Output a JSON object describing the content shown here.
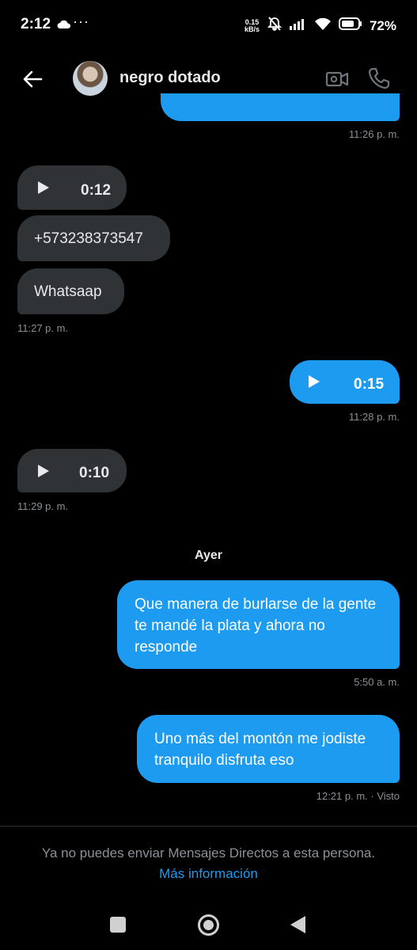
{
  "status_bar": {
    "time": "2:12",
    "dots": "···",
    "net_speed_value": "0.15",
    "net_speed_unit": "kB/s",
    "battery": "72%",
    "icons": [
      "cloud-icon",
      "mute-icon",
      "signal-icon",
      "wifi-icon",
      "battery-icon"
    ]
  },
  "header": {
    "contact_name": "negro dotado",
    "icons": [
      "back-arrow-icon",
      "video-call-icon",
      "phone-icon"
    ]
  },
  "messages": [
    {
      "direction": "out",
      "type": "text",
      "text": "",
      "timestamp": "11:26 p. m."
    },
    {
      "direction": "in",
      "type": "audio",
      "duration": "0:12"
    },
    {
      "direction": "in",
      "type": "text",
      "text": "+573238373547"
    },
    {
      "direction": "in",
      "type": "text",
      "text": "Whatsaap",
      "timestamp": "11:27 p. m."
    },
    {
      "direction": "out",
      "type": "audio",
      "duration": "0:15",
      "timestamp": "11:28 p. m."
    },
    {
      "direction": "in",
      "type": "audio",
      "duration": "0:10",
      "timestamp": "11:29 p. m."
    },
    {
      "direction": "out",
      "type": "text",
      "text": "Que manera de burlarse de la gente te mandé la plata y ahora no responde",
      "timestamp": "5:50 a. m."
    },
    {
      "direction": "out",
      "type": "text",
      "text": "Uno más del montón me jodiste tranquilo disfruta eso",
      "timestamp": "12:21 p. m. · Visto"
    }
  ],
  "day_separator": "Ayer",
  "footer": {
    "notice": "Ya no puedes enviar Mensajes Directos a esta persona.",
    "link": "Más información"
  },
  "colors": {
    "background": "#000000",
    "outgoing_bubble": "#1d9bf0",
    "incoming_bubble": "#2f3336",
    "link": "#1d9bf0",
    "muted_text": "#8b9196"
  }
}
